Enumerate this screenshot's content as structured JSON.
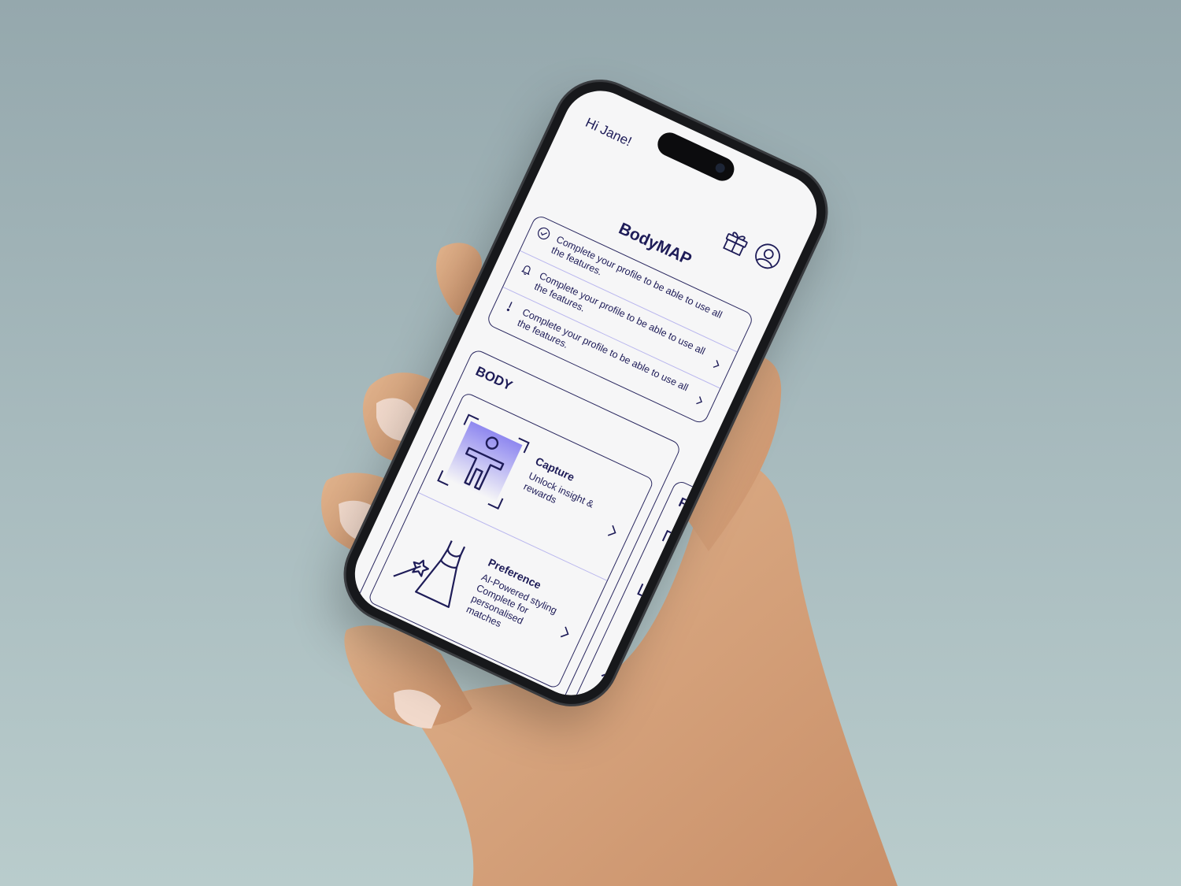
{
  "header": {
    "greeting": "Hi Jane!",
    "gift_icon": "gift-icon",
    "profile_icon": "user-circle-icon"
  },
  "app": {
    "title": "BodyMAP"
  },
  "notices": [
    {
      "icon": "check-circle-icon",
      "text": "Complete your profile to be able to use all the features."
    },
    {
      "icon": "bell-icon",
      "text": "Complete your profile to be able to use all the features."
    },
    {
      "icon": "exclamation-icon",
      "text": "Complete your profile to be able to use all the features."
    }
  ],
  "body_section": {
    "label": "BODY",
    "features": [
      {
        "title": "Capture",
        "desc": "Unlock insight & rewards",
        "icon": "body-scan-icon"
      },
      {
        "title": "Preference",
        "desc": "AI-Powered styling Complete for personalised matches",
        "icon": "dress-wand-icon"
      }
    ]
  },
  "face_section": {
    "label": "FACE"
  },
  "colors": {
    "accent": "#1e1c58",
    "divider": "#b9b6ee",
    "gradient_start": "#8f88f0",
    "screen_bg": "#f6f6f7"
  }
}
